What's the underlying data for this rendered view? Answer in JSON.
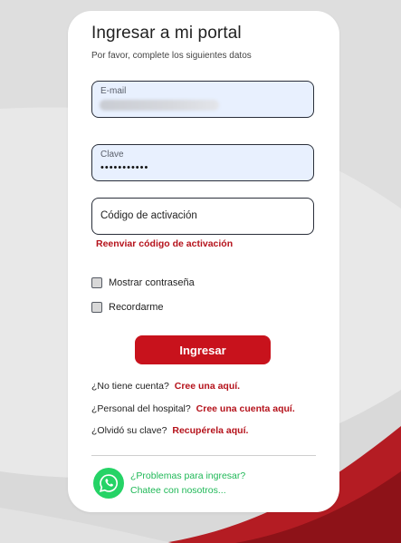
{
  "header": {
    "title": "Ingresar a mi portal",
    "subtitle": "Por favor, complete los siguientes datos"
  },
  "form": {
    "email": {
      "label": "E-mail",
      "value": ""
    },
    "password": {
      "label": "Clave",
      "value": "•••••••••••"
    },
    "activation": {
      "placeholder": "Código de activación",
      "value": ""
    },
    "resend_label": "Reenviar código de activación",
    "show_password_label": "Mostrar contraseña",
    "remember_label": "Recordarme",
    "submit_label": "Ingresar"
  },
  "links": [
    {
      "question": "¿No tiene cuenta?",
      "action": "Cree una aquí."
    },
    {
      "question": "¿Personal del hospital?",
      "action": "Cree una cuenta aquí."
    },
    {
      "question": "¿Olvidó su clave?",
      "action": "Recupérela aquí."
    }
  ],
  "support": {
    "icon": "whatsapp-icon",
    "line1": "¿Problemas para ingresar?",
    "line2": "Chatee con nosotros..."
  },
  "colors": {
    "accent": "#c8121c",
    "link": "#b5121b",
    "whatsapp": "#25d366",
    "whatsapp_text": "#1fb857",
    "field_fill": "#e8f0fe"
  }
}
